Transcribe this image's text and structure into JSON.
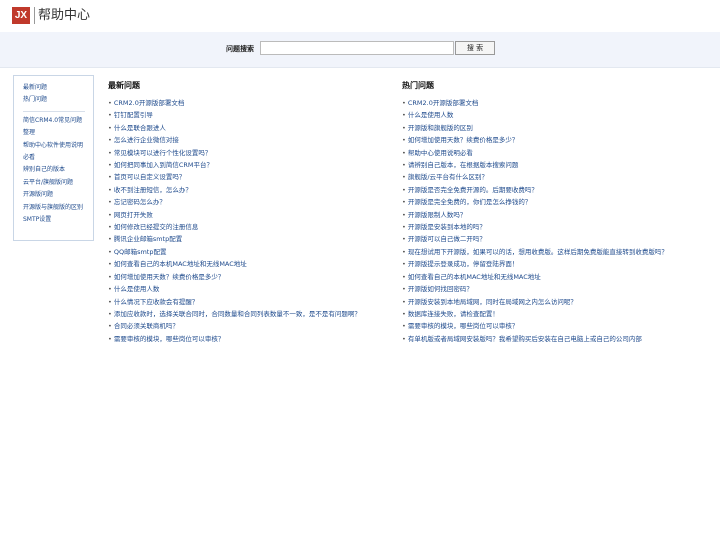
{
  "header": {
    "logo_text": "JX",
    "title": "帮助中心"
  },
  "search": {
    "label": "问题搜索",
    "placeholder": "",
    "value": "",
    "button_label": "搜 索"
  },
  "sidebar": {
    "top_items": [
      "最新问题",
      "热门问题"
    ],
    "items": [
      "简信CRM4.0常见问题",
      "整理",
      "帮助中心软件使用说明",
      "必看",
      "辨别自己的版本",
      "云平台/旗舰版问题",
      "开源版问题",
      "开源版与旗舰版的区别",
      "SMTP设置"
    ]
  },
  "latest": {
    "title": "最新问题",
    "items": [
      "CRM2.0开源版部署文档",
      "钉钉配置引导",
      "什么是联合跟进人",
      "怎么进行企业微信对接",
      "常见模块可以进行个性化设置吗？",
      "如何把同事加入到简信CRM平台？",
      "首页可以自定义设置吗？",
      "收不到注册短信，怎么办？",
      "忘记密码怎么办？",
      "网页打开失败",
      "如何修改已经提交的注册信息",
      "腾讯企业邮箱smtp配置",
      "QQ邮箱smtp配置",
      "如何查看自己的本机MAC地址和无线MAC地址",
      "如何增加使用天数？续费价格是多少？",
      "什么是使用人数",
      "什么情况下应收款会有提醒？",
      "添加应收款时，选择关联合同时，合同数量和合同列表数量不一致，是不是有问题啊？",
      "合同必须关联商机吗？",
      "需要审核的模块，哪些岗位可以审核？"
    ]
  },
  "hot": {
    "title": "热门问题",
    "items": [
      "CRM2.0开源版部署文档",
      "什么是使用人数",
      "开源版和旗舰版的区别",
      "如何增加使用天数？续费价格是多少？",
      "帮助中心使用说明必看",
      "请辨别自己版本，在根据版本搜索问题",
      "旗舰版/云平台有什么区别？",
      "开源版是否完全免费开源的。后期要收费吗？",
      "开源版是完全免费的，你们是怎么挣钱的？",
      "开源版限制人数吗？",
      "开源版是安装到本地的吗？",
      "开源版可以自己做二开吗？",
      "现在想试用下开源版，如果可以的话，想用收费版。这样后期免费版能直接转到收费版吗？",
      "开源版提示登录成功，停留登陆界面！",
      "如何查看自己的本机MAC地址和无线MAC地址",
      "开源版如何找回密码？",
      "开源版安装到本地局域网，同时在局域网之内怎么访问呢？",
      "数据库连接失败，请检查配置！",
      "需要审核的模块，哪些岗位可以审核？",
      "有单机版或者局域网安装版吗？我希望购买后安装在自己电脑上或自己的公司内部"
    ]
  },
  "colors": {
    "logo_bg": "#c0392b",
    "link": "#1e4a8c",
    "search_band_bg": "#f1f4fb",
    "sidebar_border": "#c9d6e6"
  }
}
